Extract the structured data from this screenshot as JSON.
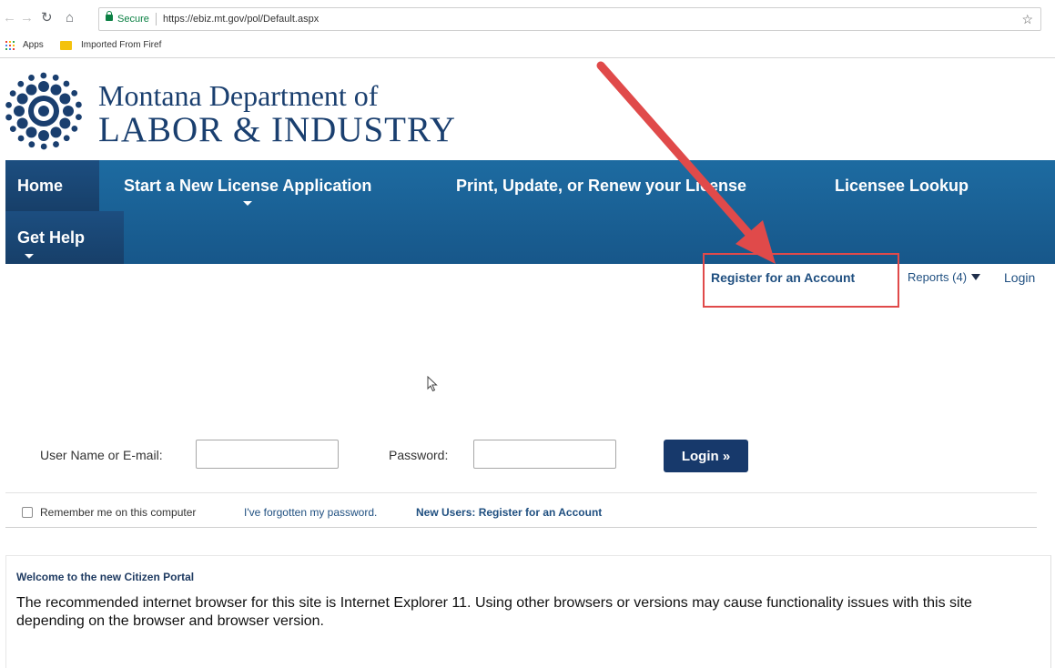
{
  "browser": {
    "secure_label": "Secure",
    "url": "https://ebiz.mt.gov/pol/Default.aspx",
    "bookmarks": [
      {
        "label": "Apps"
      },
      {
        "label": "Imported From Firef"
      }
    ],
    "icons": [
      "back-icon",
      "forward-icon",
      "reload-icon",
      "home-icon",
      "lock-icon",
      "star-icon",
      "apps-grid-icon",
      "folder-icon"
    ]
  },
  "logo": {
    "line1": "Montana Department of",
    "line2": "LABOR & INDUSTRY",
    "icon": "state-seal-icon",
    "color": "#1a3f6f"
  },
  "nav": {
    "items": [
      {
        "label": "Home"
      },
      {
        "label": "Start a New License Application"
      },
      {
        "label": "Print, Update, or Renew your License"
      },
      {
        "label": "Licensee Lookup"
      },
      {
        "label": "Get Help"
      }
    ],
    "bar_color": "#1d6ba1"
  },
  "utility": {
    "register": "Register for an Account",
    "reports": "Reports (4)",
    "login": "Login"
  },
  "login_form": {
    "username_label": "User Name or E-mail:",
    "username_value": "",
    "password_label": "Password:",
    "password_value": "",
    "submit": "Login »",
    "remember": "Remember me on this computer",
    "forgot": "I've forgotten my password.",
    "new_users": "New Users: Register for an Account",
    "button_color": "#17396b"
  },
  "welcome": {
    "title": "Welcome to the new Citizen Portal",
    "text_before": "The recommended internet browser for this site is ",
    "text_browser": "Internet Explorer 11",
    "text_after": ". Using other browsers or versions may cause functionality issues with this site depending on the browser and browser version."
  },
  "annotation": {
    "color": "#e04a4a"
  }
}
